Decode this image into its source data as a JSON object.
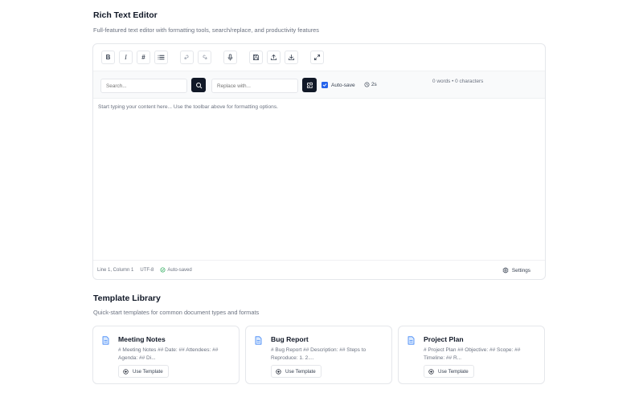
{
  "editor_section": {
    "title": "Rich Text Editor",
    "subtitle": "Full-featured text editor with formatting tools, search/replace, and productivity features"
  },
  "toolbar": {
    "buttons": [
      {
        "name": "bold",
        "label": "B",
        "icon": "bold-icon"
      },
      {
        "name": "italic",
        "label": "I",
        "icon": "italic-icon"
      },
      {
        "name": "heading",
        "label": "#",
        "icon": "hash-icon"
      },
      {
        "name": "list",
        "icon": "list-icon"
      },
      {
        "name": "undo",
        "icon": "undo-icon"
      },
      {
        "name": "redo",
        "icon": "redo-icon"
      },
      {
        "name": "voice",
        "icon": "microphone-icon"
      },
      {
        "name": "save",
        "icon": "save-icon"
      },
      {
        "name": "upload",
        "icon": "upload-icon"
      },
      {
        "name": "download",
        "icon": "download-icon"
      },
      {
        "name": "fullscreen",
        "icon": "expand-icon"
      }
    ]
  },
  "search": {
    "search_placeholder": "Search...",
    "replace_placeholder": "Replace with...",
    "autosave_label": "Auto-save",
    "autosave_checked": true,
    "interval": "2s",
    "counts": "0 words • 0 characters"
  },
  "content": {
    "placeholder": "Start typing your content here... Use the toolbar above for formatting options."
  },
  "status": {
    "position": "Line 1, Column 1",
    "encoding": "UTF-8",
    "saved": "Auto-saved",
    "settings_label": "Settings"
  },
  "templates_section": {
    "title": "Template Library",
    "subtitle": "Quick-start templates for common document types and formats",
    "button_label": "Use Template",
    "cards": [
      {
        "title": "Meeting Notes",
        "desc": "# Meeting Notes ## Date: ## Attendees: ## Agenda: ## Di..."
      },
      {
        "title": "Bug Report",
        "desc": "# Bug Report ## Description: ## Steps to Reproduce: 1. 2...."
      },
      {
        "title": "Project Plan",
        "desc": "# Project Plan ## Objective: ## Scope: ## Timeline: ## R..."
      }
    ]
  },
  "colors": {
    "primary": "#111827",
    "accent": "#2563eb",
    "success": "#16a34a",
    "muted": "#6b7280",
    "border": "#e5e7eb"
  }
}
